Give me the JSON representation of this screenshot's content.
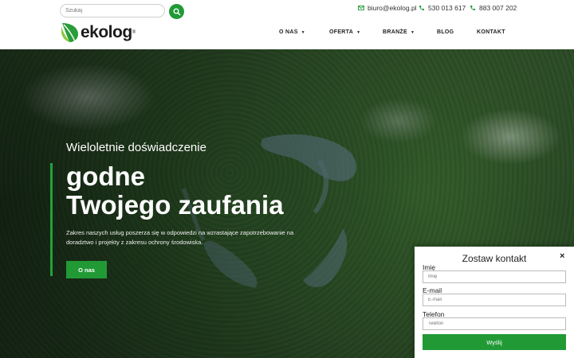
{
  "header": {
    "search_placeholder": "Szukaj",
    "logo_text": "ekolog",
    "logo_reg": "®",
    "email": "biuro@ekolog.pl",
    "phone1": "530 013 617",
    "phone2": "883 007 202",
    "nav": [
      "O NAS",
      "OFERTA",
      "BRANŻE",
      "BLOG",
      "KONTAKT"
    ]
  },
  "hero": {
    "subtitle": "Wieloletnie doświadczenie",
    "title_line1": "godne",
    "title_line2": "Twojego zaufania",
    "description": "Zakres naszych usług poszerza się w odpowiedzi na wzrastające zapotrzebowanie na doradztwo i projekty z zakresu ochrony środowiska.",
    "button": "O nas"
  },
  "contact_panel": {
    "title": "Zostaw kontakt",
    "close": "×",
    "name_label": "Imię",
    "name_placeholder": "Imię",
    "email_label": "E-mail",
    "email_placeholder": "E-mail",
    "phone_label": "Telefon",
    "phone_placeholder": "Telefon",
    "submit": "Wyślij"
  },
  "colors": {
    "accent": "#219a36",
    "text": "#222222"
  },
  "icons": [
    "search-icon",
    "leaf-logo-icon",
    "mail-icon",
    "phone-icon",
    "caret-down-icon",
    "close-icon"
  ]
}
